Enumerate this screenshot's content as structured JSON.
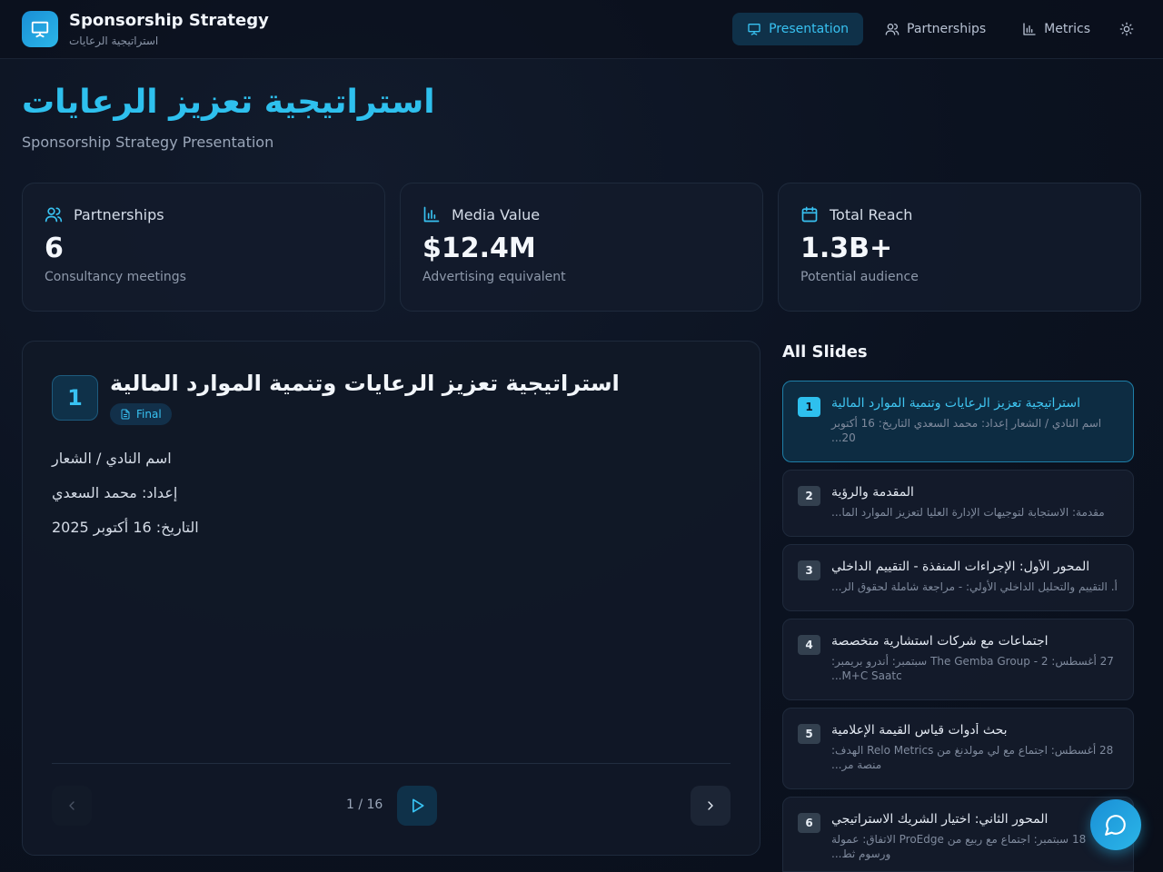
{
  "header": {
    "title": "Sponsorship Strategy",
    "subtitle": "استراتيجية الرعايات",
    "nav": [
      {
        "label": "Presentation",
        "icon": "presentation-icon",
        "active": true
      },
      {
        "label": "Partnerships",
        "icon": "users-icon",
        "active": false
      },
      {
        "label": "Metrics",
        "icon": "bar-chart-icon",
        "active": false
      }
    ],
    "theme_icon": "sun-icon"
  },
  "hero": {
    "title": "استراتيجية تعزيز الرعايات",
    "subtitle": "Sponsorship Strategy Presentation"
  },
  "stats": [
    {
      "label": "Partnerships",
      "value": "6",
      "desc": "Consultancy meetings",
      "icon": "users-icon"
    },
    {
      "label": "Media Value",
      "value": "$12.4M",
      "desc": "Advertising equivalent",
      "icon": "bar-chart-icon"
    },
    {
      "label": "Total Reach",
      "value": "1.3B+",
      "desc": "Potential audience",
      "icon": "calendar-icon"
    }
  ],
  "current_slide": {
    "number": "1",
    "title": "استراتيجية تعزيز الرعايات وتنمية الموارد المالية",
    "badge": "Final",
    "lines": [
      "اسم النادي / الشعار",
      "إعداد: محمد السعدي",
      "التاريخ: 16 أكتوبر 2025"
    ],
    "counter": "1 / 16"
  },
  "all_slides": {
    "heading": "All Slides",
    "items": [
      {
        "num": "1",
        "title": "استراتيجية تعزيز الرعايات وتنمية الموارد المالية",
        "desc": "اسم النادي / الشعار إعداد: محمد السعدي التاريخ: 16 أكتوبر 20...",
        "active": true
      },
      {
        "num": "2",
        "title": "المقدمة والرؤية",
        "desc": "مقدمة: الاستجابة لتوجيهات الإدارة العليا لتعزيز الموارد الما...",
        "active": false
      },
      {
        "num": "3",
        "title": "المحور الأول: الإجراءات المنفذة - التقييم الداخلي",
        "desc": "أ. التقييم والتحليل الداخلي الأولي: - مراجعة شاملة لحقوق الر...",
        "active": false
      },
      {
        "num": "4",
        "title": "اجتماعات مع شركات استشارية متخصصة",
        "desc": "27 أغسطس: The Gemba Group - 2 سبتمبر: أندرو بريمبر: M+C Saatc...",
        "active": false
      },
      {
        "num": "5",
        "title": "بحث أدوات قياس القيمة الإعلامية",
        "desc": "28 أغسطس: اجتماع مع لي مولدنغ من Relo Metrics الهدف: منصة مر...",
        "active": false
      },
      {
        "num": "6",
        "title": "المحور الثاني: اختيار الشريك الاستراتيجي",
        "desc": "18 سبتمبر: اجتماع مع ربيع من ProEdge الاتفاق: عمولة ورسوم ثط...",
        "active": false
      }
    ]
  }
}
